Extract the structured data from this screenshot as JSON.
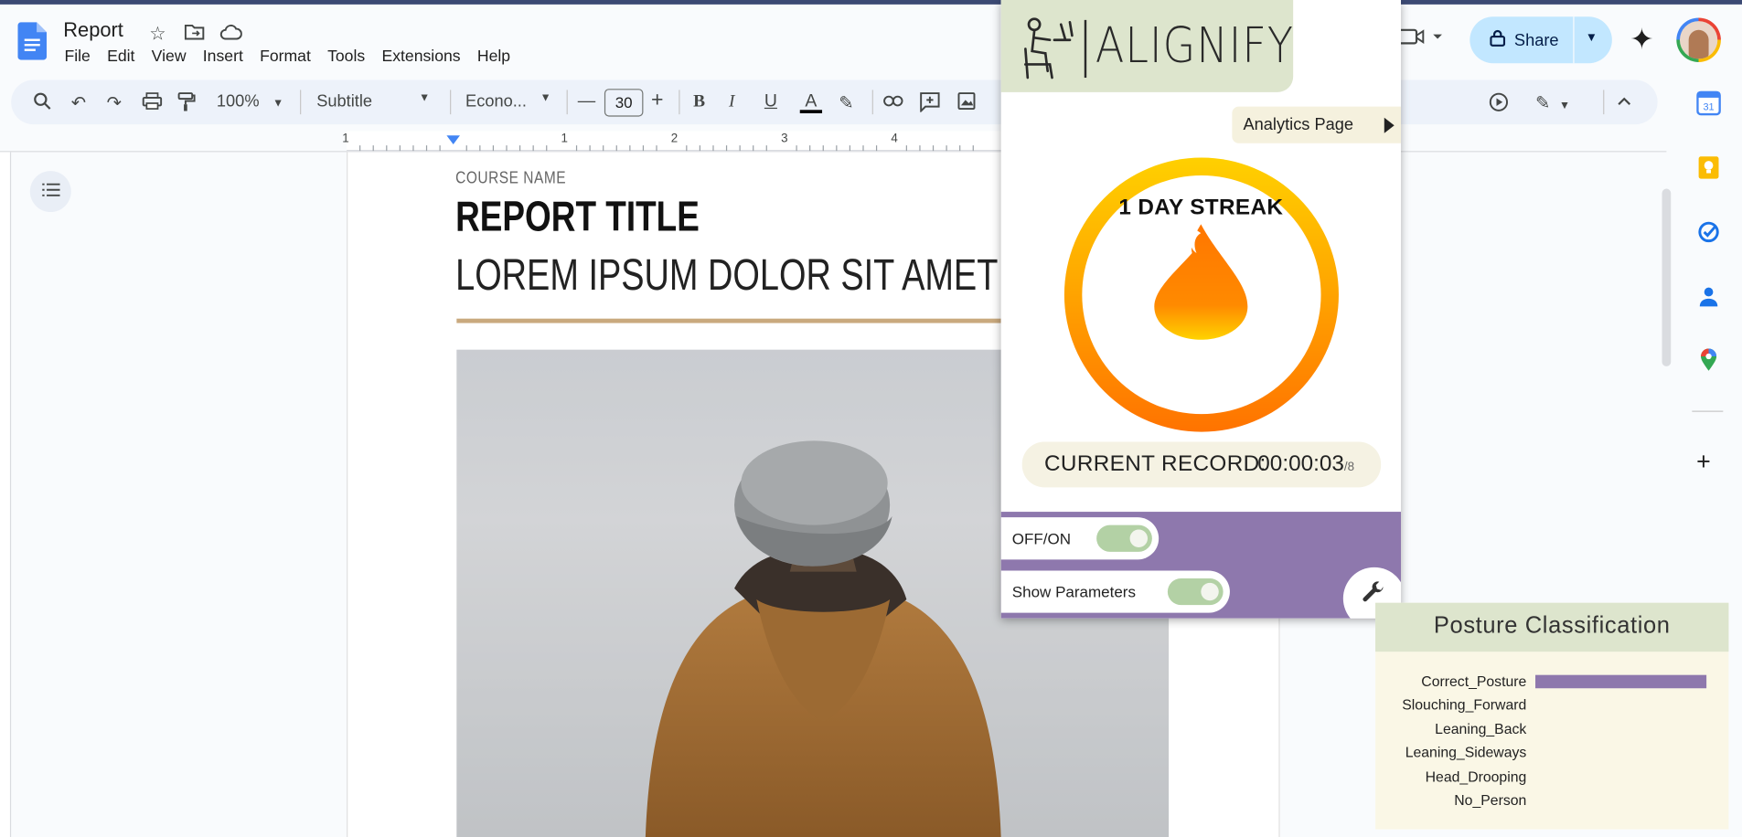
{
  "doc": {
    "title": "Report",
    "menus": [
      "File",
      "Edit",
      "View",
      "Insert",
      "Format",
      "Tools",
      "Extensions",
      "Help"
    ],
    "share_label": "Share"
  },
  "toolbar": {
    "zoom": "100%",
    "style": "Subtitle",
    "font": "Econo...",
    "font_size": "30"
  },
  "ruler": {
    "labels": [
      "1",
      "1",
      "2",
      "3",
      "4"
    ]
  },
  "page": {
    "course": "COURSE NAME",
    "title": "REPORT TITLE",
    "subtitle": "LOREM IPSUM DOLOR SIT AMET"
  },
  "alignify": {
    "brand": "ALIGNIFY",
    "analytics_label": "Analytics Page",
    "streak": "1 DAY STREAK",
    "record_label": "CURRENT RECORD:",
    "record_value": "00:00:03",
    "record_suffix": "/8",
    "toggle_onoff": {
      "label": "OFF/ON",
      "on": true
    },
    "toggle_params": {
      "label": "Show Parameters",
      "on": true
    },
    "colors": {
      "purple": "#8e78ad",
      "green": "#dde5cd",
      "cream": "#f5f2e3",
      "flame": "#ff7300"
    }
  },
  "posture": {
    "title": "Posture Classification",
    "classes": [
      {
        "label": "Correct_Posture",
        "value": 1.0
      },
      {
        "label": "Slouching_Forward",
        "value": 0
      },
      {
        "label": "Leaning_Back",
        "value": 0
      },
      {
        "label": "Leaning_Sideways",
        "value": 0
      },
      {
        "label": "Head_Drooping",
        "value": 0
      },
      {
        "label": "No_Person",
        "value": 0
      }
    ]
  },
  "icons": {
    "rail": [
      "calendar-icon",
      "keep-icon",
      "tasks-icon",
      "contacts-icon",
      "maps-icon"
    ]
  }
}
